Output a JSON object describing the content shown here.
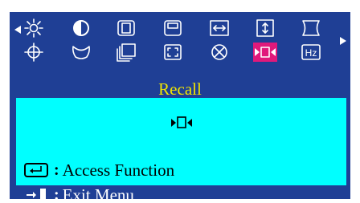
{
  "osd": {
    "title": "Recall",
    "colors": {
      "background": "#1f3f95",
      "title": "#f2e600",
      "panel": "#00ffff",
      "selected": "#e0197b",
      "icon": "#ffffff"
    },
    "nav": {
      "left": "triangle-left-icon",
      "right": "triangle-right-icon"
    },
    "top_row_icons": [
      "brightness-icon",
      "contrast-icon",
      "size-icon",
      "position-icon",
      "h-size-icon",
      "v-size-icon",
      "pincushion-icon"
    ],
    "bottom_row_icons": [
      "tilt-icon",
      "trapezoid-icon",
      "parallelogram-icon",
      "corner-icon",
      "degauss-icon",
      "recall-icon",
      "hz-icon"
    ],
    "hz_label": "Hz",
    "selected_icon": "recall-icon",
    "panel": {
      "icon": "recall-icon",
      "enter_hint": {
        "key_icon": "enter-key-icon",
        "separator": ":",
        "text": "Access Function"
      }
    },
    "exit_hint": {
      "key_icon": "exit-door-icon",
      "separator": ":",
      "text": "Exit Menu"
    }
  }
}
